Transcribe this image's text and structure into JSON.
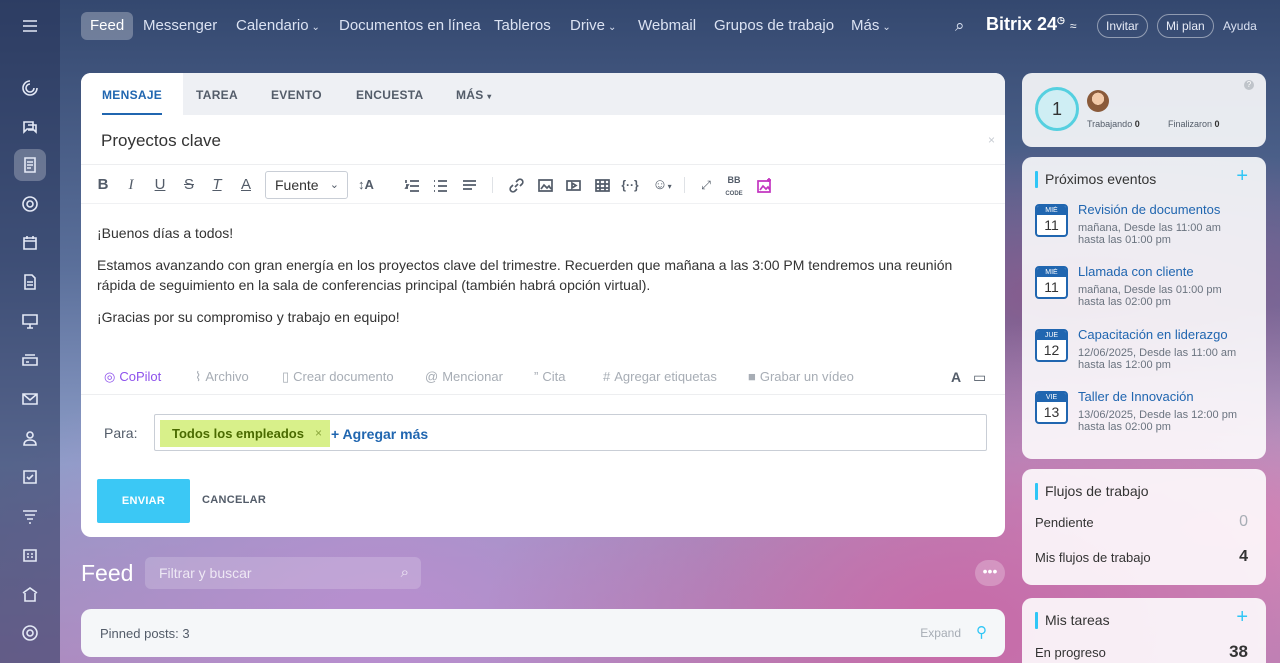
{
  "nav": {
    "items": [
      {
        "label": "Feed"
      },
      {
        "label": "Messenger"
      },
      {
        "label": "Calendario"
      },
      {
        "label": "Documentos en línea"
      },
      {
        "label": "Tableros"
      },
      {
        "label": "Drive"
      },
      {
        "label": "Webmail"
      },
      {
        "label": "Grupos de trabajo"
      },
      {
        "label": "Más"
      }
    ],
    "brand": "Bitrix 24",
    "invite": "Invitar",
    "plan": "Mi plan",
    "help": "Ayuda"
  },
  "composer": {
    "tabs": [
      "MENSAJE",
      "TAREA",
      "EVENTO",
      "ENCUESTA",
      "MÁS"
    ],
    "title": "Proyectos clave",
    "font_label": "Fuente",
    "body": [
      "¡Buenos días a todos!",
      "Estamos avanzando con gran energía en los proyectos clave del trimestre. Recuerden que mañana a las 3:00 PM tendremos una reunión rápida de seguimiento en la sala de conferencias principal (también habrá opción virtual).",
      "¡Gracias por su compromiso y trabajo en equipo!"
    ],
    "attachments": [
      "CoPilot",
      "Archivo",
      "Crear documento",
      "Mencionar",
      "Cita",
      "Agregar etiquetas",
      "Grabar un vídeo"
    ],
    "to_label": "Para:",
    "recipient": "Todos los empleados",
    "add_more": "+ Agregar más",
    "send": "ENVIAR",
    "cancel": "CANCELAR"
  },
  "feed": {
    "title": "Feed",
    "filter_placeholder": "Filtrar y buscar",
    "pinned": "Pinned posts: 3",
    "expand": "Expand"
  },
  "status_card": {
    "count": "1",
    "working_label": "Trabajando",
    "working": "0",
    "finished_label": "Finalizaron",
    "finished": "0"
  },
  "events_card": {
    "title": "Próximos eventos",
    "events": [
      {
        "day": "MIÉ",
        "num": "11",
        "title": "Revisión de documentos",
        "line1": "mañana, Desde las 11:00 am",
        "line2": "hasta las 01:00 pm"
      },
      {
        "day": "MIÉ",
        "num": "11",
        "title": "Llamada con cliente",
        "line1": "mañana, Desde las 01:00 pm",
        "line2": "hasta las 02:00 pm"
      },
      {
        "day": "JUE",
        "num": "12",
        "title": "Capacitación en liderazgo",
        "line1": "12/06/2025, Desde las 11:00 am",
        "line2": "hasta las 12:00 pm"
      },
      {
        "day": "VIE",
        "num": "13",
        "title": "Taller de Innovación",
        "line1": "13/06/2025, Desde las 12:00 pm",
        "line2": "hasta las 02:00 pm"
      }
    ]
  },
  "workflows_card": {
    "title": "Flujos de trabajo",
    "pending_label": "Pendiente",
    "pending": "0",
    "mine_label": "Mis flujos de trabajo",
    "mine": "4"
  },
  "tasks_card": {
    "title": "Mis tareas",
    "in_progress_label": "En progreso",
    "in_progress": "38"
  }
}
